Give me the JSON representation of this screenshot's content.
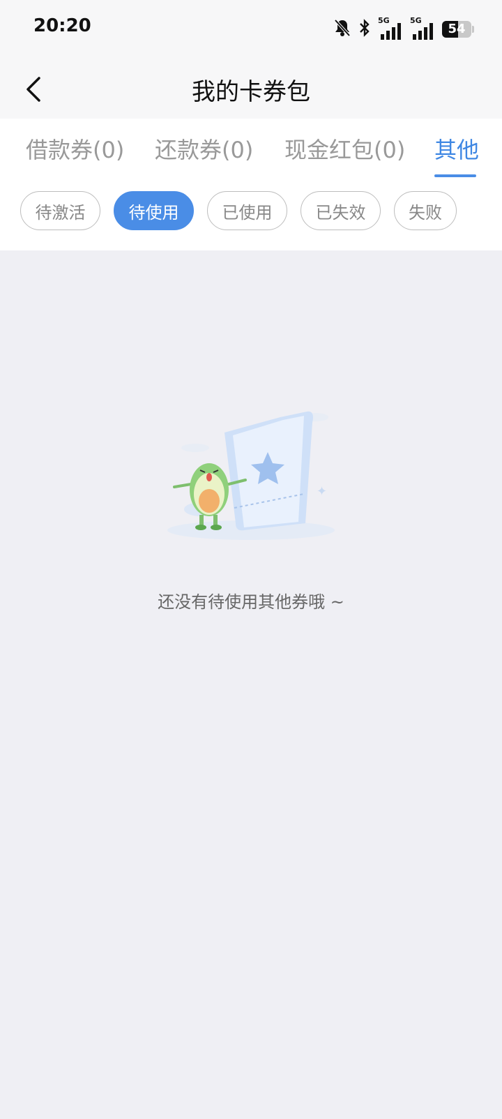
{
  "status_bar": {
    "time": "20:20",
    "network_1": "5G",
    "network_2": "5G",
    "battery": "54",
    "icons": [
      "bell-mute-icon",
      "bluetooth-icon",
      "signal-icon",
      "signal-icon",
      "battery-icon"
    ]
  },
  "header": {
    "title": "我的卡券包",
    "back_icon": "chevron-left-icon"
  },
  "tabs": [
    {
      "label": "借款券(0)",
      "active": false
    },
    {
      "label": "还款券(0)",
      "active": false
    },
    {
      "label": "现金红包(0)",
      "active": false
    },
    {
      "label": "其他",
      "active": true
    }
  ],
  "filters": [
    {
      "label": "待激活",
      "active": false
    },
    {
      "label": "待使用",
      "active": true
    },
    {
      "label": "已使用",
      "active": false
    },
    {
      "label": "已失效",
      "active": false
    },
    {
      "label": "失败",
      "active": false
    }
  ],
  "empty_state": {
    "message": "还没有待使用其他券哦 ~"
  },
  "colors": {
    "accent": "#4a8de6",
    "background": "#efeff4",
    "tab_inactive": "#999999"
  }
}
